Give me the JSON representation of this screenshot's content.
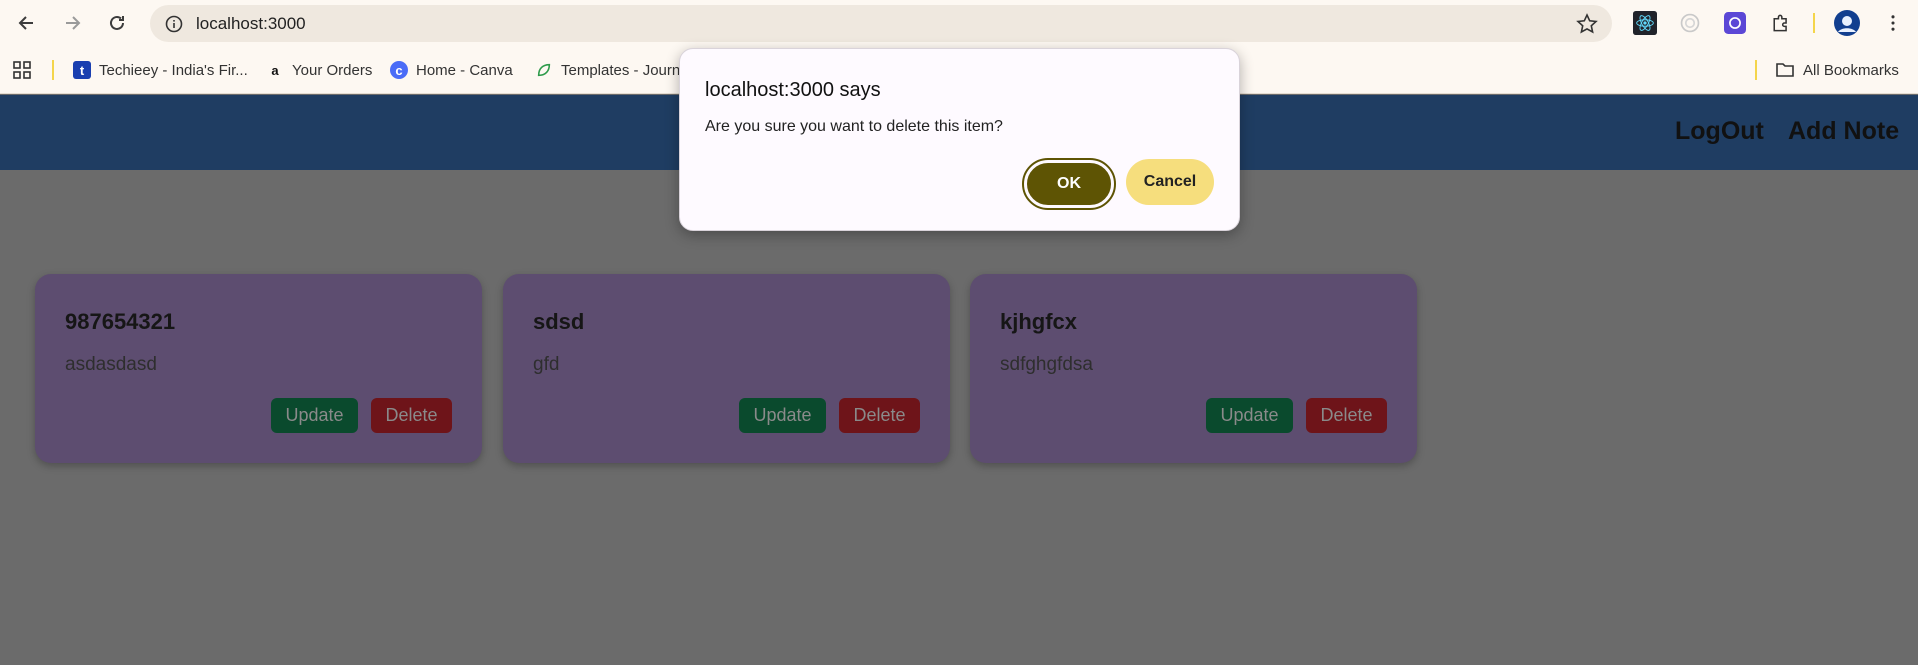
{
  "browser": {
    "url": "localhost:3000",
    "bookmarks": [
      {
        "label": "Techieey - India's Fir...",
        "icon": "t",
        "color": "#1a3fb0"
      },
      {
        "label": "Your Orders",
        "icon": "a",
        "color": "#ff9900"
      },
      {
        "label": "Home - Canva",
        "icon": "c",
        "color": "#4a6cf7"
      },
      {
        "label": "Templates - Journ",
        "icon": "leaf",
        "color": "#2e9b4b"
      }
    ],
    "all_bookmarks": "All Bookmarks"
  },
  "app": {
    "nav": {
      "logout": "LogOut",
      "add_note": "Add Note"
    },
    "notes": [
      {
        "title": "987654321",
        "body": "asdasdasd",
        "update": "Update",
        "delete": "Delete"
      },
      {
        "title": "sdsd",
        "body": "gfd",
        "update": "Update",
        "delete": "Delete"
      },
      {
        "title": "kjhgfcx",
        "body": "sdfghgfdsa",
        "update": "Update",
        "delete": "Delete"
      }
    ]
  },
  "dialog": {
    "title": "localhost:3000 says",
    "message": "Are you sure you want to delete this item?",
    "ok": "OK",
    "cancel": "Cancel"
  },
  "colors": {
    "appbar": "#1f3d62",
    "card": "#5d4d70",
    "update_button": "#0a4a2d",
    "delete_button": "#6e1419",
    "ok_button": "#5e5404",
    "cancel_button": "#f6de7d"
  }
}
